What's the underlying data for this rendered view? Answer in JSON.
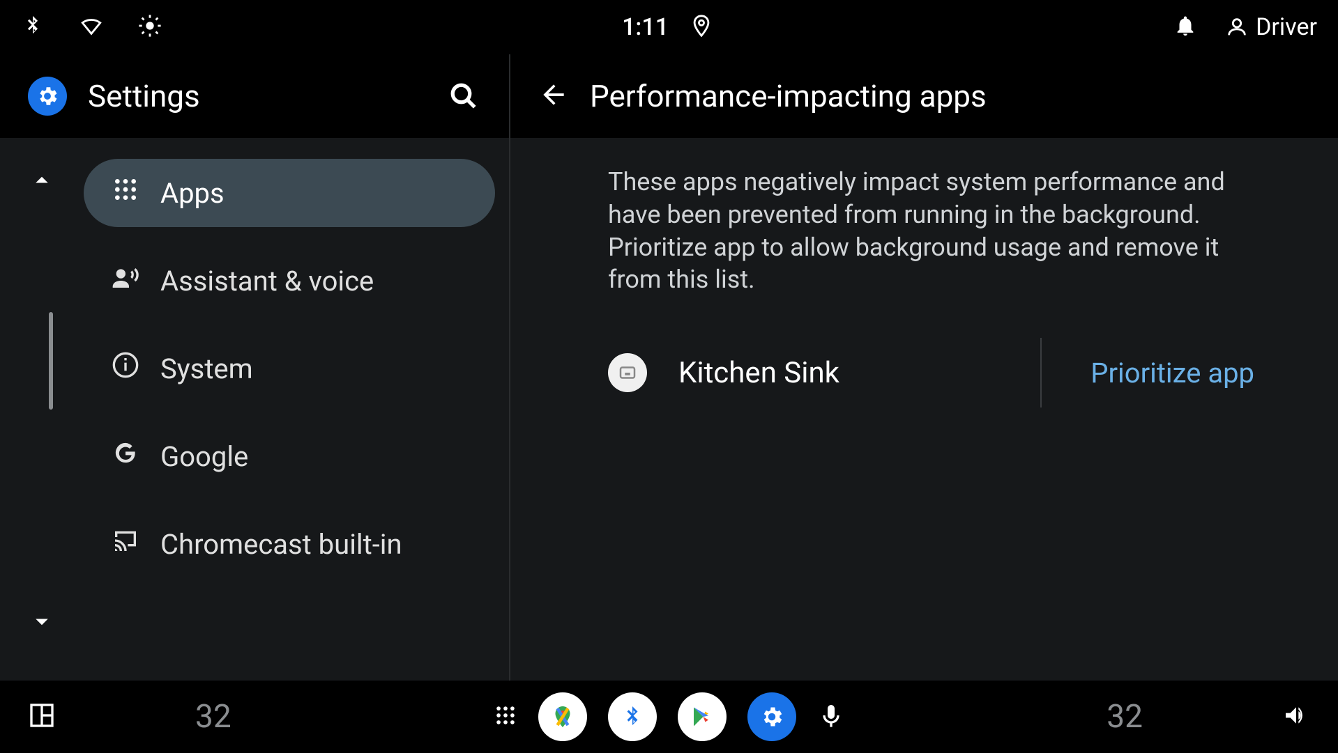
{
  "status": {
    "time": "1:11",
    "user_label": "Driver"
  },
  "sidebar": {
    "title": "Settings",
    "items": [
      {
        "label": "Apps",
        "icon": "grid-icon",
        "selected": true
      },
      {
        "label": "Assistant & voice",
        "icon": "assistant-voice-icon",
        "selected": false
      },
      {
        "label": "System",
        "icon": "info-icon",
        "selected": false
      },
      {
        "label": "Google",
        "icon": "google-g-icon",
        "selected": false
      },
      {
        "label": "Chromecast built-in",
        "icon": "cast-icon",
        "selected": false
      }
    ]
  },
  "detail": {
    "title": "Performance-impacting apps",
    "description": "These apps negatively impact system performance and have been prevented from running in the background.\nPrioritize app to allow background usage and remove it from this list.",
    "apps": [
      {
        "name": "Kitchen Sink",
        "action": "Prioritize app"
      }
    ]
  },
  "dock": {
    "temp_left": "32",
    "temp_right": "32"
  },
  "colors": {
    "accent": "#1a73e8",
    "link": "#6ab0e6"
  }
}
